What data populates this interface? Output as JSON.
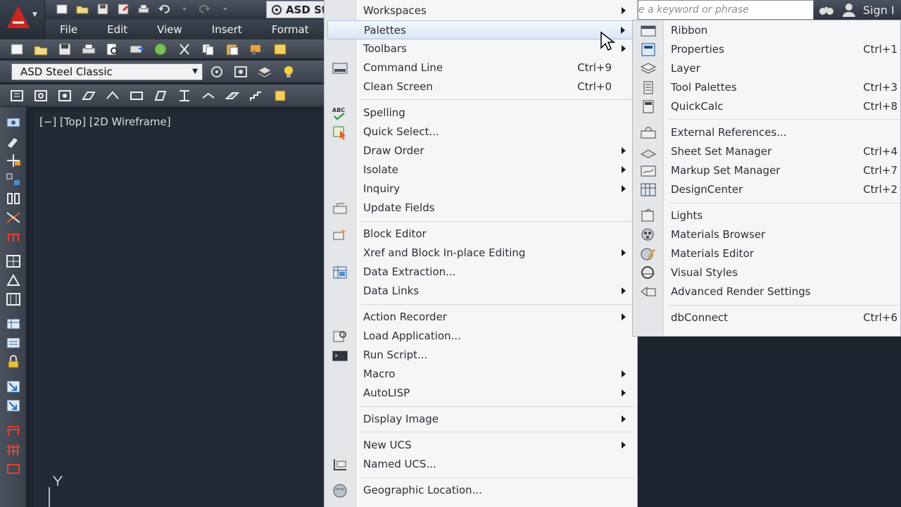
{
  "workspace_box": {
    "label": "ASD St"
  },
  "menubar": {
    "items": [
      "File",
      "Edit",
      "View",
      "Insert",
      "Format"
    ]
  },
  "toolbar": {
    "style_select_value": "ASD Steel Classic"
  },
  "viewport": {
    "label": "[−] [Top] [2D Wireframe]",
    "ucs_axis": "Y"
  },
  "search": {
    "placeholder": "e a keyword or phrase"
  },
  "signin": {
    "label": "Sign I"
  },
  "menu": {
    "items": [
      {
        "label": "Workspaces",
        "shortcut": ""
      },
      {
        "label": "Palettes",
        "shortcut": ""
      },
      {
        "label": "Toolbars",
        "shortcut": ""
      },
      {
        "label": "Command Line",
        "shortcut": "Ctrl+9"
      },
      {
        "label": "Clean Screen",
        "shortcut": "Ctrl+0"
      },
      {
        "label": "Spelling",
        "shortcut": ""
      },
      {
        "label": "Quick Select...",
        "shortcut": ""
      },
      {
        "label": "Draw Order",
        "shortcut": ""
      },
      {
        "label": "Isolate",
        "shortcut": ""
      },
      {
        "label": "Inquiry",
        "shortcut": ""
      },
      {
        "label": "Update Fields",
        "shortcut": ""
      },
      {
        "label": "Block Editor",
        "shortcut": ""
      },
      {
        "label": "Xref and Block In-place Editing",
        "shortcut": ""
      },
      {
        "label": "Data Extraction...",
        "shortcut": ""
      },
      {
        "label": "Data Links",
        "shortcut": ""
      },
      {
        "label": "Action Recorder",
        "shortcut": ""
      },
      {
        "label": "Load Application...",
        "shortcut": ""
      },
      {
        "label": "Run Script...",
        "shortcut": ""
      },
      {
        "label": "Macro",
        "shortcut": ""
      },
      {
        "label": "AutoLISP",
        "shortcut": ""
      },
      {
        "label": "Display Image",
        "shortcut": ""
      },
      {
        "label": "New UCS",
        "shortcut": ""
      },
      {
        "label": "Named UCS...",
        "shortcut": ""
      },
      {
        "label": "Geographic Location...",
        "shortcut": ""
      }
    ],
    "spelling_icon_text": "ABC"
  },
  "submenu": {
    "items": [
      {
        "label": "Ribbon",
        "shortcut": ""
      },
      {
        "label": "Properties",
        "shortcut": "Ctrl+1"
      },
      {
        "label": "Layer",
        "shortcut": ""
      },
      {
        "label": "Tool Palettes",
        "shortcut": "Ctrl+3"
      },
      {
        "label": "QuickCalc",
        "shortcut": "Ctrl+8"
      },
      {
        "label": "External References...",
        "shortcut": ""
      },
      {
        "label": "Sheet Set Manager",
        "shortcut": "Ctrl+4"
      },
      {
        "label": "Markup Set Manager",
        "shortcut": "Ctrl+7"
      },
      {
        "label": "DesignCenter",
        "shortcut": "Ctrl+2"
      },
      {
        "label": "Lights",
        "shortcut": ""
      },
      {
        "label": "Materials Browser",
        "shortcut": ""
      },
      {
        "label": "Materials Editor",
        "shortcut": ""
      },
      {
        "label": "Visual Styles",
        "shortcut": ""
      },
      {
        "label": "Advanced Render Settings",
        "shortcut": ""
      },
      {
        "label": "dbConnect",
        "shortcut": "Ctrl+6"
      }
    ]
  },
  "colors": {
    "accent_red": "#c8261f",
    "highlight": "#dbe7f5",
    "canvas": "#222a36"
  }
}
